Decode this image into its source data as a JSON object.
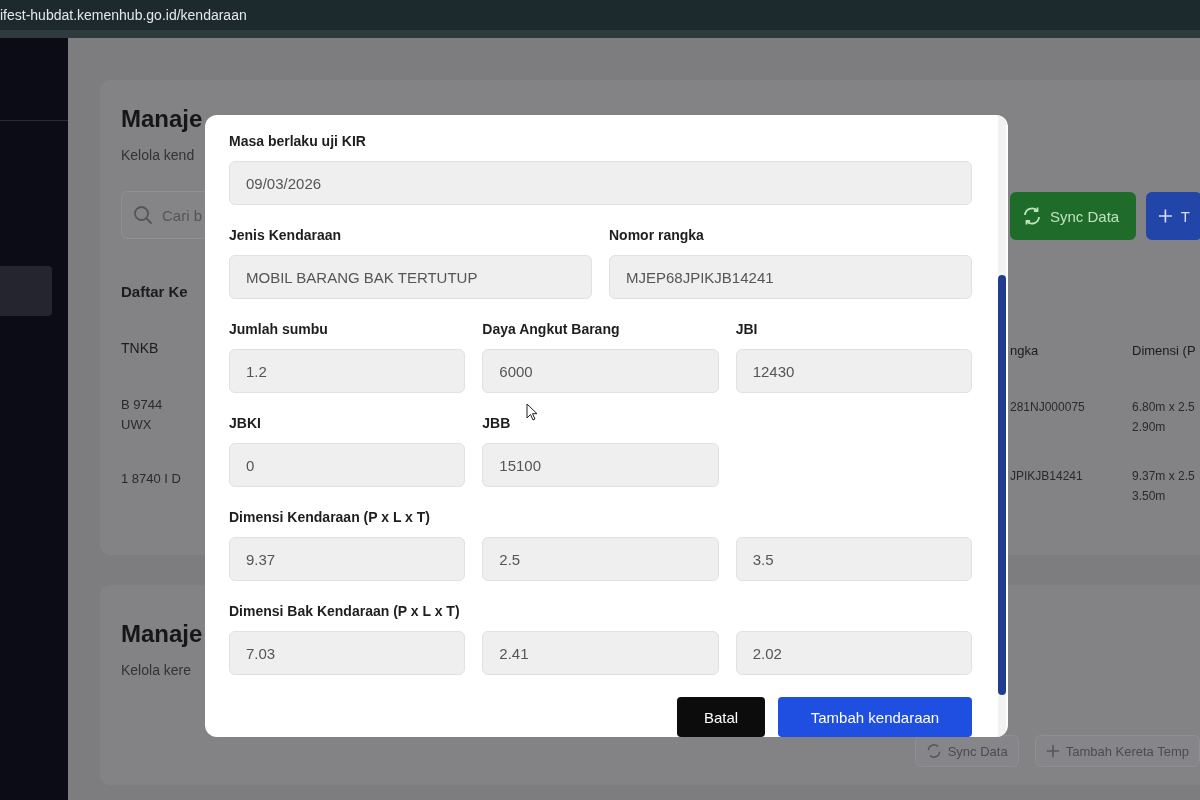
{
  "browser": {
    "url": "ifest-hubdat.kemenhub.go.id/kendaraan"
  },
  "page": {
    "title": "Manaje",
    "subtitle": "Kelola kend",
    "search": {
      "placeholder": "Cari b"
    },
    "buttons": [
      {
        "label": "Sync Data",
        "kind": "sync"
      },
      {
        "label": "T",
        "kind": "add"
      }
    ],
    "table": {
      "title": "Daftar Ke",
      "columns": [
        "TNKB",
        "ngka",
        "Dimensi (P"
      ],
      "rows": [
        {
          "cells": [
            "B 9744 UWX",
            "281NJ000075",
            "6.80m x 2.5 2.90m"
          ]
        },
        {
          "cells": [
            "1 8740 I D",
            "JPIKJB14241",
            "9.37m x 2.5 3.50m"
          ]
        }
      ]
    }
  },
  "section_2": {
    "title": "Manaje",
    "subtitle": "Kelola kere",
    "buttons": [
      {
        "label": "Sync Data",
        "kind": "sync"
      },
      {
        "label": "Tambah Kereta Temp",
        "kind": "add"
      }
    ]
  },
  "modal": {
    "rows": [
      {
        "kind": "single",
        "fields": [
          {
            "label": "Masa berlaku uji KIR",
            "value": "09/03/2026"
          }
        ]
      },
      {
        "kind": "pair",
        "fields": [
          {
            "label": "Jenis Kendaraan",
            "value": "MOBIL BARANG BAK TERTUTUP"
          },
          {
            "label": "Nomor rangka",
            "value": "MJEP68JPIKJB14241"
          }
        ]
      },
      {
        "kind": "triple",
        "fields": [
          {
            "label": "Jumlah sumbu",
            "value": "1.2"
          },
          {
            "label": "Daya Angkut Barang",
            "value": "6000"
          },
          {
            "label": "JBI",
            "value": "12430"
          }
        ]
      },
      {
        "kind": "triple",
        "fields": [
          {
            "label": "JBKI",
            "value": "0"
          },
          {
            "label": "JBB",
            "value": "15100"
          }
        ]
      },
      {
        "kind": "dimensions",
        "label": "Dimensi Kendaraan (P x L x T)",
        "fields": [
          {
            "value": "9.37"
          },
          {
            "value": "2.5"
          },
          {
            "value": "3.5"
          }
        ]
      },
      {
        "kind": "dimensions",
        "label": "Dimensi Bak Kendaraan (P x L x T)",
        "fields": [
          {
            "value": "7.03"
          },
          {
            "value": "2.41"
          },
          {
            "value": "2.02"
          }
        ]
      }
    ],
    "buttons": [
      {
        "label": "Batal",
        "kind": "secondary"
      },
      {
        "label": "Tambah kendaraan",
        "kind": "primary"
      }
    ]
  }
}
